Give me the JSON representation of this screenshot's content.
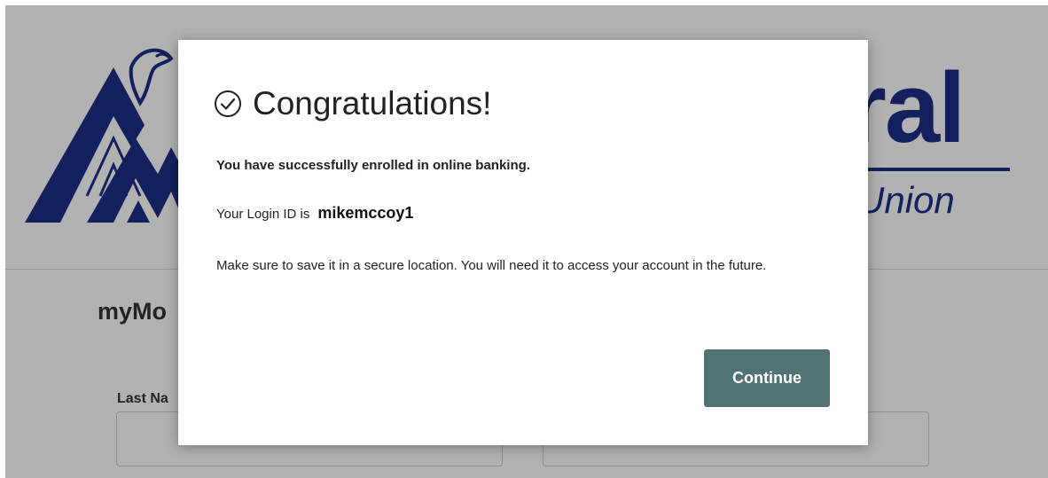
{
  "background": {
    "logo": {
      "word": "eral",
      "subtitle": "dit Union",
      "color": "#1d2f86"
    },
    "form_title": "myMo",
    "field_label": "Last Na"
  },
  "modal": {
    "title": "Congratulations!",
    "icon": "check-circle-icon",
    "success_message": "You have successfully enrolled in online banking.",
    "login_prefix": "Your Login ID is",
    "login_id": "mikemccoy1",
    "save_message": "Make sure to save it in a secure location. You will need it to access your account in the future.",
    "continue_label": "Continue",
    "button_color": "#527373"
  }
}
